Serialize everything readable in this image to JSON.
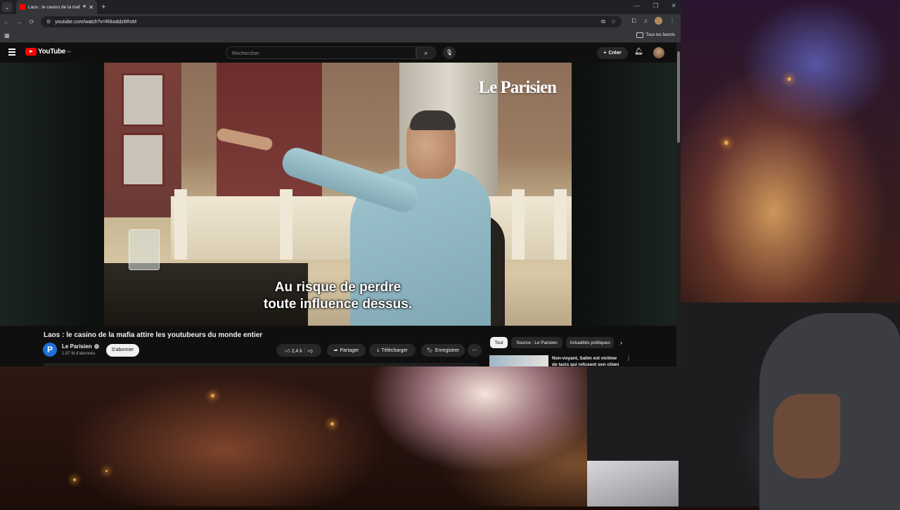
{
  "browser": {
    "tab": {
      "title": "Laos : le casino de la mafia",
      "audio_icon": "speaker-icon",
      "close": "✕"
    },
    "new_tab": "+",
    "window_controls": [
      "—",
      "❐",
      "✕"
    ],
    "nav": {
      "back": "←",
      "forward": "→",
      "reload": "⟳"
    },
    "url": "youtube.com/watch?v=RIkoddz6RsM",
    "bookmarks": {
      "all_favorites": "Tous les favoris"
    }
  },
  "youtube": {
    "logo_text": "YouTube",
    "logo_country": "FR",
    "search_placeholder": "Rechercher",
    "create_label": "Créer",
    "video": {
      "watermark": "Le Parisien",
      "subtitle_line1": "Au risque de perdre",
      "subtitle_line2": "toute influence dessus.",
      "title": "Laos : le casino de la mafia attire les youtubeurs du monde entier"
    },
    "channel": {
      "avatar_letter": "P",
      "name": "Le Parisien",
      "subscribers": "1,97 M d'abonnés",
      "subscribe_label": "S'abonner"
    },
    "actions": {
      "likes": "2,4 k",
      "share": "Partager",
      "download": "Télécharger",
      "save": "Enregistrer",
      "more": "⋯"
    },
    "chips": [
      "Tout",
      "Source : Le Parisien",
      "Actualités politiques"
    ],
    "recommendation": {
      "title": "Non-voyant, Salim est victime de taxis qui refusent son chien"
    }
  },
  "colors": {
    "yt_red": "#ff0000",
    "bg": "#0f0f0f",
    "channel_blue": "#1f6fd6"
  }
}
